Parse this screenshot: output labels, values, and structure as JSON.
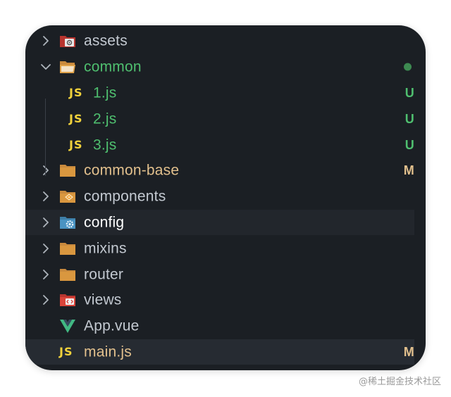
{
  "explorer": {
    "items": [
      {
        "label": "assets",
        "badge": "",
        "label_color": "#c3c9d1",
        "badge_color": ""
      },
      {
        "label": "common",
        "badge": "",
        "label_color": "#4fbf6f",
        "badge_color": "#3d8a51"
      },
      {
        "label": "1.js",
        "badge": "U",
        "label_color": "#4fbf6f",
        "badge_color": "#4fbf6f"
      },
      {
        "label": "2.js",
        "badge": "U",
        "label_color": "#4fbf6f",
        "badge_color": "#4fbf6f"
      },
      {
        "label": "3.js",
        "badge": "U",
        "label_color": "#4fbf6f",
        "badge_color": "#4fbf6f"
      },
      {
        "label": "common-base",
        "badge": "M",
        "label_color": "#e2c08d",
        "badge_color": "#e2c08d"
      },
      {
        "label": "components",
        "badge": "",
        "label_color": "#c3c9d1",
        "badge_color": ""
      },
      {
        "label": "config",
        "badge": "",
        "label_color": "#ffffff",
        "badge_color": ""
      },
      {
        "label": "mixins",
        "badge": "",
        "label_color": "#c3c9d1",
        "badge_color": ""
      },
      {
        "label": "router",
        "badge": "",
        "label_color": "#c3c9d1",
        "badge_color": ""
      },
      {
        "label": "views",
        "badge": "",
        "label_color": "#c3c9d1",
        "badge_color": ""
      },
      {
        "label": "App.vue",
        "badge": "",
        "label_color": "#c3c9d1",
        "badge_color": ""
      },
      {
        "label": "main.js",
        "badge": "M",
        "label_color": "#e2c08d",
        "badge_color": "#e2c08d"
      }
    ],
    "js_glyph": "JS"
  },
  "icons": {
    "chevron_right": "chevron-right-icon",
    "chevron_down": "chevron-down-icon",
    "folder_assets": "folder-assets-icon",
    "folder_open": "folder-open-icon",
    "folder": "folder-icon",
    "folder_components": "folder-components-icon",
    "folder_config": "folder-config-icon",
    "folder_views": "folder-views-icon",
    "vue_file": "vue-file-icon",
    "js_file": "js-file-icon"
  },
  "colors": {
    "background": "#1b1f24",
    "folder": "#c98a3d",
    "js": "#f1d23c",
    "git_untracked": "#4fbf6f",
    "git_modified": "#e2c08d",
    "vue": "#41b883"
  },
  "watermark": "@稀土掘金技术社区"
}
